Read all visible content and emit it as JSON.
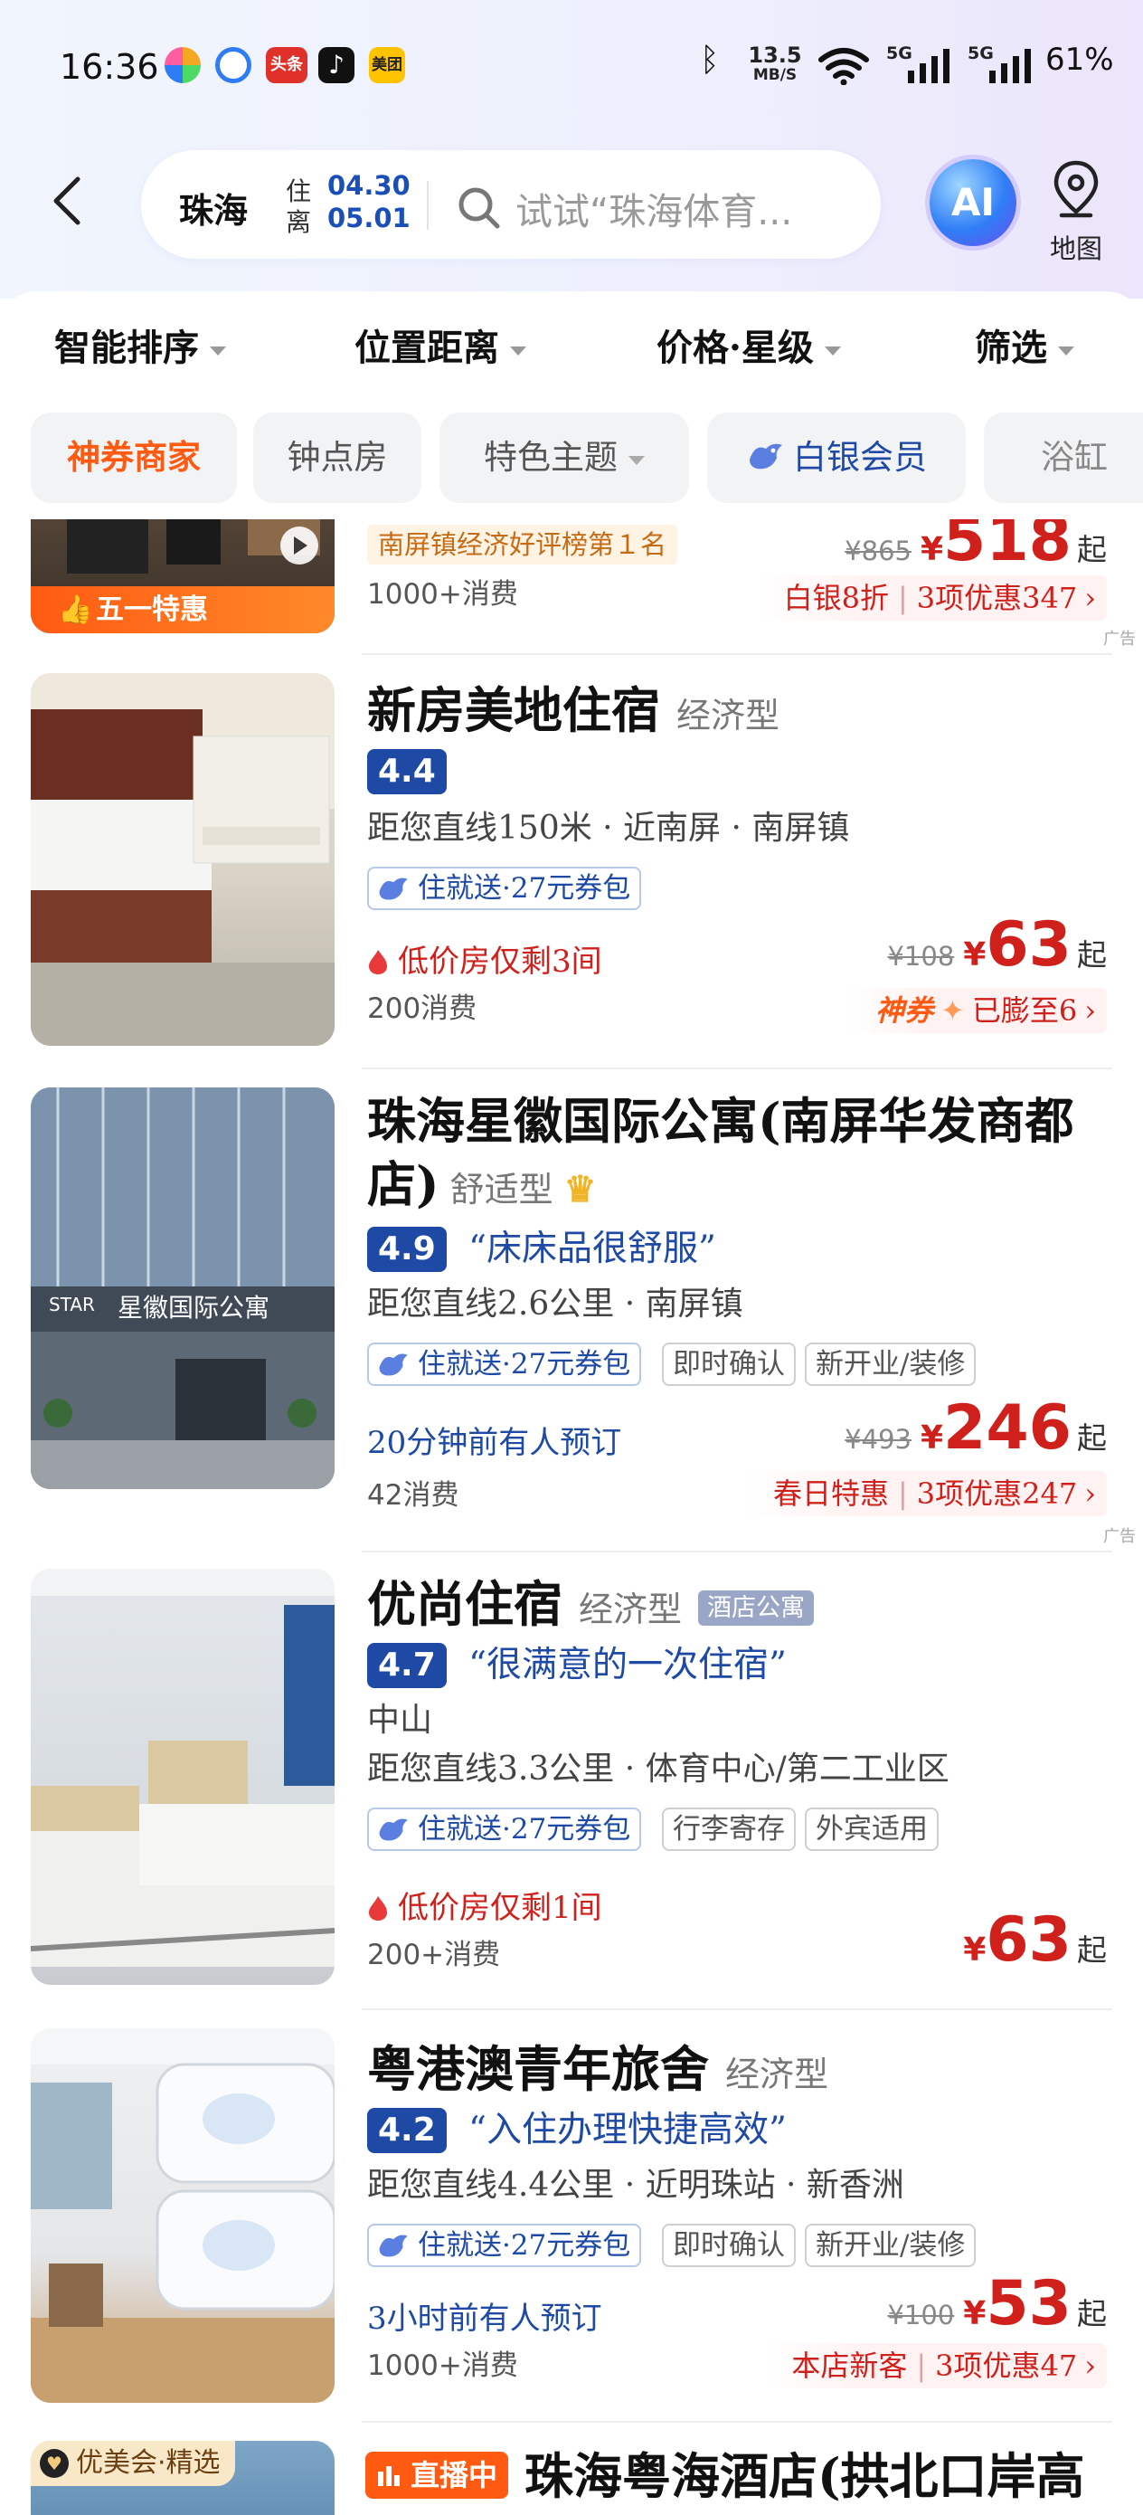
{
  "status_bar": {
    "time": "16:36",
    "app_icons": [
      {
        "name": "pinwheel-app-icon",
        "color": "#5aa0f0"
      },
      {
        "name": "quark-app-icon",
        "color": "#2f7df6"
      },
      {
        "name": "toutiao-app-icon",
        "color": "#e0302a",
        "label": "头条"
      },
      {
        "name": "douyin-app-icon",
        "color": "#111111"
      },
      {
        "name": "meituan-app-icon",
        "color": "#ffc300",
        "label": "美团"
      }
    ],
    "network_speed_value": "13.5",
    "network_speed_unit": "MB/S",
    "signal_1_label": "5G",
    "signal_2_label": "5G",
    "battery": "61%"
  },
  "search": {
    "city": "珠海",
    "checkin_label": "住",
    "checkout_label": "离",
    "checkin_date": "04.30",
    "checkout_date": "05.01",
    "placeholder": "试试“珠海体育..."
  },
  "ai_button_label": "AI",
  "map_button_label": "地图",
  "sort_bar": [
    {
      "label": "智能排序"
    },
    {
      "label": "位置距离"
    },
    {
      "label": "价格·星级"
    },
    {
      "label": "筛选"
    }
  ],
  "quick_filters": [
    {
      "label": "神券商家"
    },
    {
      "label": "钟点房"
    },
    {
      "label": "特色主题"
    },
    {
      "label": "白银会员"
    },
    {
      "label": "浴缸"
    }
  ],
  "colors": {
    "brand_blue": "#1e4aa6",
    "price_red": "#d0201b",
    "promo_orange": "#ff6a00"
  },
  "ad_label": "广告",
  "top_partial": {
    "ribbon": "五一特惠",
    "rank_badge": "南屏镇经济好评榜第１名",
    "consumption": "1000+消费",
    "orig_price": "¥865",
    "currency": "¥",
    "price": "518",
    "price_suffix": "起",
    "promo_left": "白银8折",
    "promo_right": "3项优惠347"
  },
  "hotels": [
    {
      "name": "新房美地住宿",
      "type": "经济型",
      "score": "4.4",
      "distance": "距您直线150米 · 近南屏 · 南屏镇",
      "tags": [
        "住就送·27元券包"
      ],
      "notice": "低价房仅剩3间",
      "consumption": "200消费",
      "orig_price": "¥108",
      "currency": "¥",
      "price": "63",
      "price_suffix": "起",
      "promo_brand": "神券",
      "promo_text": "已膨至6"
    },
    {
      "name": "珠海星徽国际公寓(南屏华发商都",
      "name2": "店)",
      "type": "舒适型",
      "score": "4.9",
      "quote": "“床床品很舒服”",
      "distance": "距您直线2.6公里 · 南屏镇",
      "tags": [
        "住就送·27元券包",
        "即时确认",
        "新开业/装修"
      ],
      "notice": "20分钟前有人预订",
      "consumption": "42消费",
      "orig_price": "¥493",
      "currency": "¥",
      "price": "246",
      "price_suffix": "起",
      "promo_left": "春日特惠",
      "promo_right": "3项优惠247",
      "building_sign": "星徽国际公寓",
      "building_logo": "STAR"
    },
    {
      "name": "优尚住宿",
      "type": "经济型",
      "badge": "酒店公寓",
      "score": "4.7",
      "quote": "“很满意的一次住宿”",
      "area": "中山",
      "distance": "距您直线3.3公里 · 体育中心/第二工业区",
      "tags": [
        "住就送·27元券包",
        "行李寄存",
        "外宾适用"
      ],
      "notice": "低价房仅剩1间",
      "consumption": "200+消费",
      "currency": "¥",
      "price": "63",
      "price_suffix": "起"
    },
    {
      "name": "粤港澳青年旅舍",
      "type": "经济型",
      "score": "4.2",
      "quote": "“入住办理快捷高效”",
      "distance": "距您直线4.4公里 · 近明珠站 · 新香洲",
      "tags": [
        "住就送·27元券包",
        "即时确认",
        "新开业/装修"
      ],
      "notice": "3小时前有人预订",
      "consumption": "1000+消费",
      "orig_price": "¥100",
      "currency": "¥",
      "price": "53",
      "price_suffix": "起",
      "promo_left": "本店新客",
      "promo_right": "3项优惠47"
    },
    {
      "thumb_badge": "优美会·精选",
      "live_badge": "直播中",
      "name": "珠海粤海酒店(拱北口岸高"
    }
  ]
}
